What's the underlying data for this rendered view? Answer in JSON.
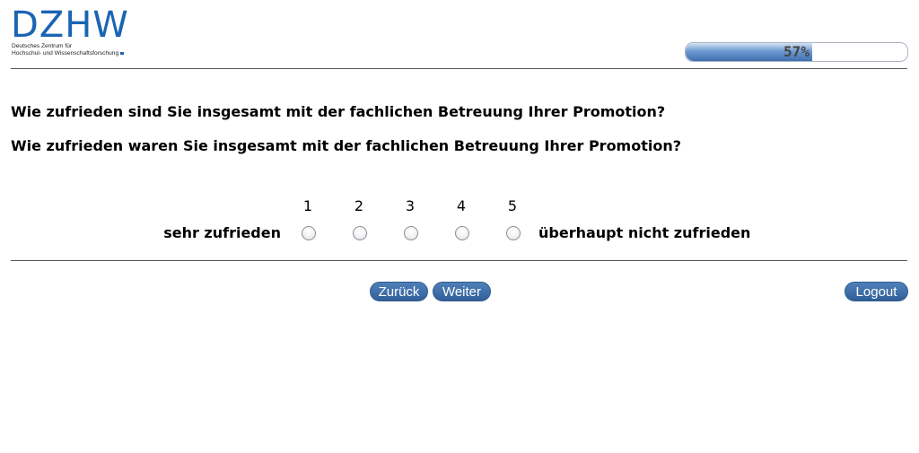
{
  "header": {
    "logo_text": "DZHW",
    "logo_subtitle_line1": "Deutsches Zentrum für",
    "logo_subtitle_line2": "Hochschul- und Wissenschaftsforschung",
    "brand_color": "#1a64b4"
  },
  "progress": {
    "value": 57,
    "label": "57%"
  },
  "questions": [
    "Wie zufrieden sind Sie insgesamt mit der fachlichen Betreuung Ihrer Promotion?",
    "Wie zufrieden waren Sie insgesamt mit der fachlichen Betreuung Ihrer Promotion?"
  ],
  "scale": {
    "left_label": "sehr zufrieden",
    "right_label": "überhaupt nicht zufrieden",
    "options": [
      "1",
      "2",
      "3",
      "4",
      "5"
    ],
    "selected": null
  },
  "buttons": {
    "back": "Zurück",
    "next": "Weiter",
    "logout": "Logout"
  },
  "colors": {
    "button": "#3f6fa9",
    "progress_fill": "#4f7fb8"
  }
}
